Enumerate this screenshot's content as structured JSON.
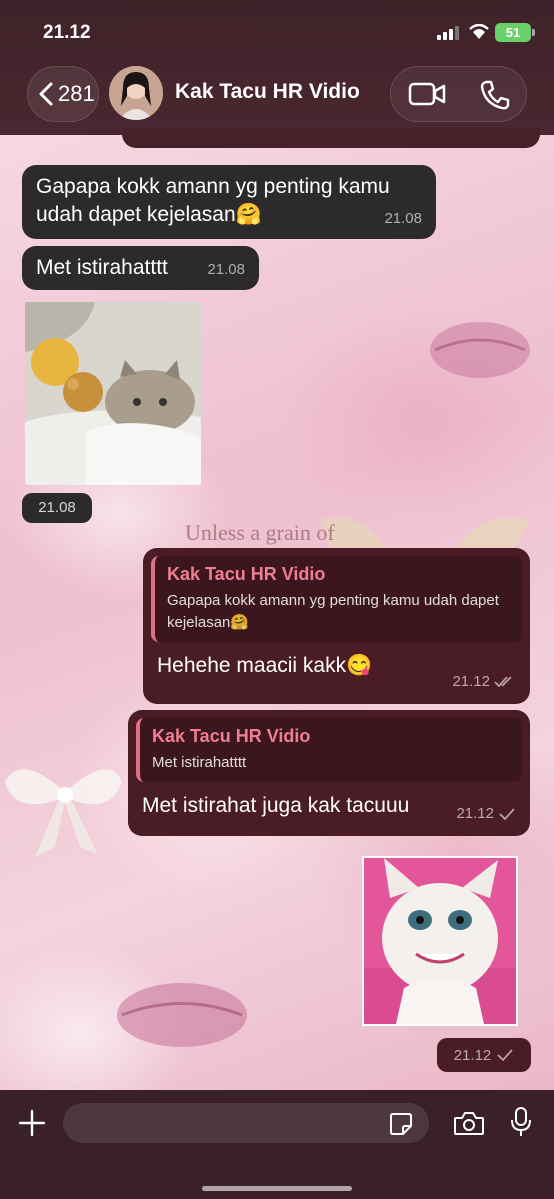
{
  "status_bar": {
    "time": "21.12",
    "battery": "51"
  },
  "header": {
    "back_count": "281",
    "contact_name": "Kak Tacu HR Vidio"
  },
  "wallpaper": {
    "text": "Unless a grain of"
  },
  "messages": [
    {
      "text": "Gapapa kokk amann yg penting kamu udah dapet kejelasan🤗",
      "time": "21.08"
    },
    {
      "text": "Met istirahatttt",
      "time": "21.08"
    },
    {
      "time": "21.08"
    },
    {
      "quote_name": "Kak Tacu HR Vidio",
      "quote_text": "Gapapa kokk amann yg penting kamu udah dapet kejelasan🤗",
      "text": "Hehehe maacii kakk😋",
      "time": "21.12",
      "status": "read"
    },
    {
      "quote_name": "Kak Tacu HR Vidio",
      "quote_text": "Met istirahatttt",
      "text": "Met istirahat juga kak tacuuu",
      "time": "21.12",
      "status": "sent"
    },
    {
      "time": "21.12",
      "status": "sent"
    }
  ],
  "composer": {
    "value": ""
  },
  "colors": {
    "incoming": "#2c2a2b",
    "outgoing": "#4a1c26",
    "quote_accent": "#e46f84"
  }
}
